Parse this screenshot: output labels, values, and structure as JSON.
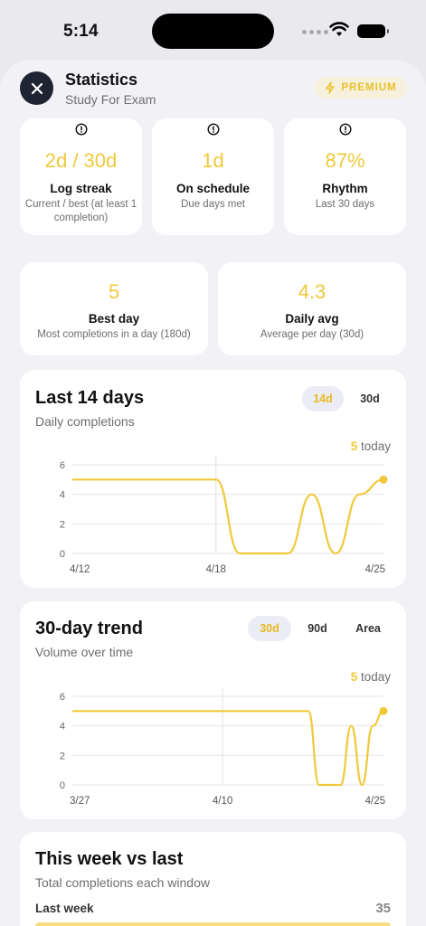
{
  "status": {
    "time": "5:14"
  },
  "header": {
    "title": "Statistics",
    "subtitle": "Study For Exam",
    "premium_label": "PREMIUM"
  },
  "stats_top": [
    {
      "value": "2d / 30d",
      "label": "Log streak",
      "caption": "Current / best (at least 1 completion)"
    },
    {
      "value": "1d",
      "label": "On schedule",
      "caption": "Due days met"
    },
    {
      "value": "87%",
      "label": "Rhythm",
      "caption": "Last 30 days"
    }
  ],
  "stats_mid": [
    {
      "value": "5",
      "label": "Best day",
      "caption": "Most completions in a day (180d)"
    },
    {
      "value": "4.3",
      "label": "Daily avg",
      "caption": "Average per day (30d)"
    }
  ],
  "last14": {
    "title": "Last 14 days",
    "subtitle": "Daily completions",
    "toggles": [
      "14d",
      "30d"
    ],
    "active_toggle": "14d",
    "today_value": "5",
    "today_label": "today"
  },
  "trend30": {
    "title": "30-day trend",
    "subtitle": "Volume over time",
    "toggles": [
      "30d",
      "90d",
      "Area"
    ],
    "active_toggle": "30d",
    "today_value": "5",
    "today_label": "today"
  },
  "week_compare": {
    "title": "This week vs last",
    "subtitle": "Total completions each window",
    "rows": [
      {
        "label": "Last week",
        "value": "35"
      }
    ]
  },
  "chart_data": [
    {
      "type": "line",
      "x": [
        "4/12",
        "4/13",
        "4/14",
        "4/15",
        "4/16",
        "4/17",
        "4/18",
        "4/19",
        "4/20",
        "4/21",
        "4/22",
        "4/23",
        "4/24",
        "4/25"
      ],
      "values": [
        5,
        5,
        5,
        5,
        5,
        5,
        5,
        0,
        0,
        0,
        4,
        0,
        4,
        5
      ],
      "xticks": [
        "4/12",
        "4/18",
        "4/25"
      ],
      "yticks": [
        0,
        2,
        4,
        6
      ],
      "ylim": [
        0,
        6
      ],
      "color": "#f0c93a"
    },
    {
      "type": "line",
      "x": [
        "3/27",
        "3/28",
        "3/29",
        "3/30",
        "3/31",
        "4/1",
        "4/2",
        "4/3",
        "4/4",
        "4/5",
        "4/6",
        "4/7",
        "4/8",
        "4/9",
        "4/10",
        "4/11",
        "4/12",
        "4/13",
        "4/14",
        "4/15",
        "4/16",
        "4/17",
        "4/18",
        "4/19",
        "4/20",
        "4/21",
        "4/22",
        "4/23",
        "4/24",
        "4/25"
      ],
      "values": [
        5,
        5,
        5,
        5,
        5,
        5,
        5,
        5,
        5,
        5,
        5,
        5,
        5,
        5,
        5,
        5,
        5,
        5,
        5,
        5,
        5,
        5,
        5,
        0,
        0,
        0,
        4,
        0,
        4,
        5
      ],
      "xticks": [
        "3/27",
        "4/10",
        "4/25"
      ],
      "yticks": [
        0,
        2,
        4,
        6
      ],
      "ylim": [
        0,
        6
      ],
      "color": "#f0c93a"
    }
  ]
}
